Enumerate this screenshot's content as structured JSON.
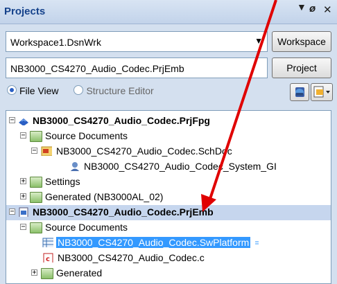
{
  "panel": {
    "title": "Projects",
    "dropdown_glyph": "▼",
    "pin_glyph": "ø",
    "close_glyph": "✕"
  },
  "workspace": {
    "combo_value": "Workspace1.DsnWrk",
    "button_label": "Workspace"
  },
  "project": {
    "field_value": "NB3000_CS4270_Audio_Codec.PrjEmb",
    "button_label": "Project"
  },
  "view": {
    "options": [
      {
        "label": "File View",
        "selected": true
      },
      {
        "label": "Structure Editor",
        "selected": false
      }
    ]
  },
  "tree": {
    "items": [
      {
        "label": "NB3000_CS4270_Audio_Codec.PrjFpg",
        "expander": "−",
        "icon": "fpga-project-icon",
        "bold": true
      },
      {
        "label": "Source Documents",
        "expander": "−",
        "icon": "folder-icon"
      },
      {
        "label": "NB3000_CS4270_Audio_Codec.SchDoc",
        "expander": "−",
        "icon": "schematic-doc-icon"
      },
      {
        "label": "NB3000_CS4270_Audio_Codec_System_GI",
        "icon": "component-icon"
      },
      {
        "label": "Settings",
        "expander": "+",
        "icon": "folder-icon"
      },
      {
        "label": "Generated (NB3000AL_02)",
        "expander": "+",
        "icon": "folder-icon"
      },
      {
        "label": "NB3000_CS4270_Audio_Codec.PrjEmb",
        "expander": "−",
        "icon": "embedded-project-icon",
        "bold": true
      },
      {
        "label": "Source Documents",
        "expander": "−",
        "icon": "folder-icon"
      },
      {
        "label": "NB3000_CS4270_Audio_Codec.SwPlatform",
        "icon": "sw-platform-icon"
      },
      {
        "label": "NB3000_CS4270_Audio_Codec.c",
        "icon": "c-file-icon"
      },
      {
        "label": "Generated",
        "expander": "+",
        "icon": "folder-icon"
      }
    ]
  },
  "colors": {
    "accent": "#3399ff",
    "arrow": "#e00000",
    "panel_bg": "#d4e0ef"
  }
}
